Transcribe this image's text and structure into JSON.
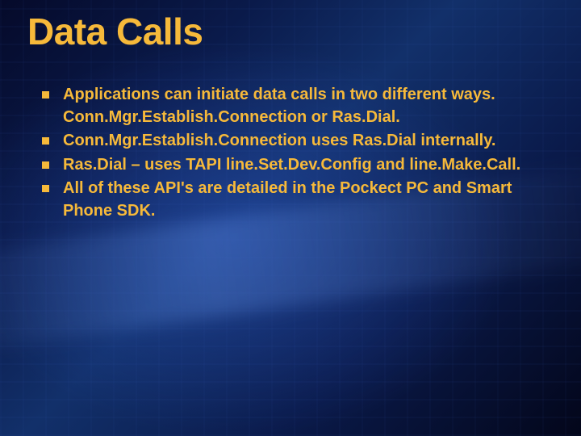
{
  "slide": {
    "title": "Data Calls",
    "bullets": [
      "Applications can initiate data calls in two different ways.  Conn.Mgr.Establish.Connection or Ras.Dial.",
      "Conn.Mgr.Establish.Connection uses Ras.Dial internally.",
      "Ras.Dial – uses TAPI line.Set.Dev.Config and line.Make.Call.",
      "All of these API's are detailed in the Pockect PC and Smart Phone SDK."
    ]
  }
}
